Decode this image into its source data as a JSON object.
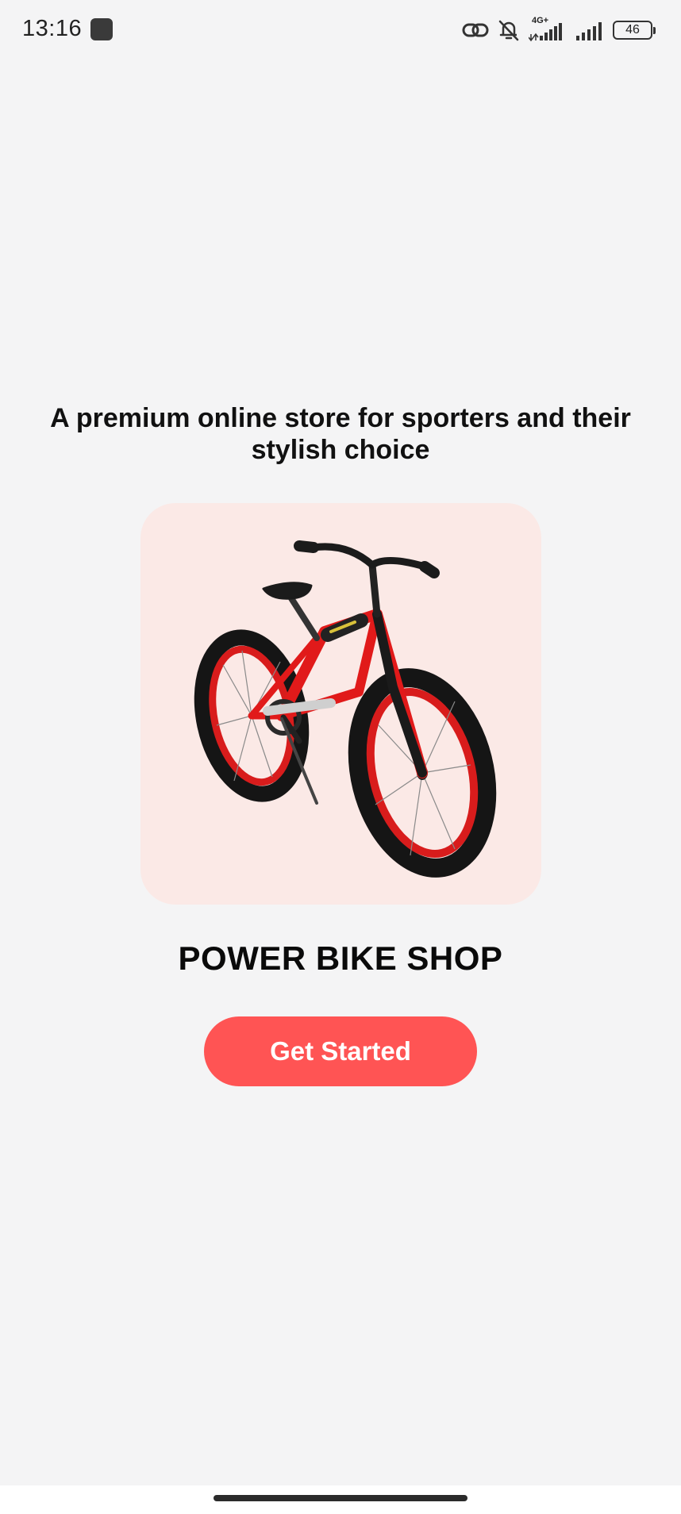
{
  "status_bar": {
    "time": "13:16",
    "network_type": "4G+",
    "battery_level": "46",
    "icons": [
      "link-icon",
      "bell-off-icon",
      "signal-4g-icon",
      "signal-icon",
      "battery-icon"
    ]
  },
  "onboarding": {
    "headline": "A premium online store for sporters and their stylish choice",
    "product_image": "red-bicycle",
    "shop_name": "POWER BIKE SHOP",
    "cta_label": "Get Started"
  },
  "colors": {
    "background": "#f4f4f5",
    "card": "#fbe9e6",
    "accent": "#ff5454",
    "bike_frame": "#e11a1a"
  }
}
